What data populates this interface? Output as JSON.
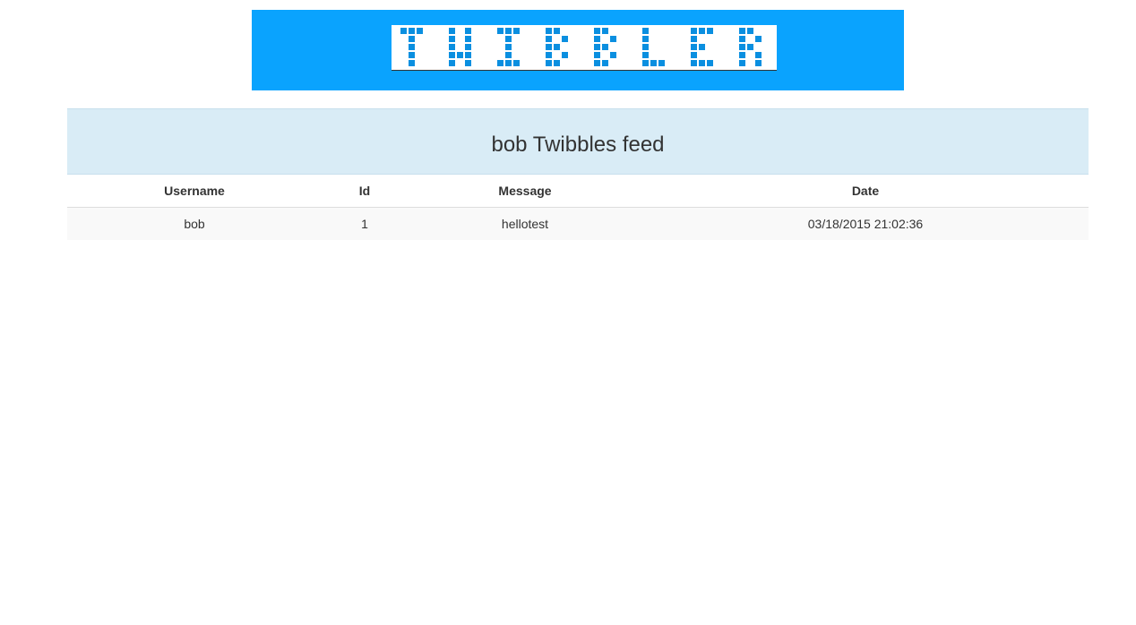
{
  "header": {
    "logo_text": "TWIBBLER",
    "banner_color": "#0aa3fe",
    "logo_pixel_color": "#0a8fe0"
  },
  "feed": {
    "title": "bob Twibbles feed",
    "heading_bg": "#d9ecf6",
    "columns": [
      "Username",
      "Id",
      "Message",
      "Date"
    ],
    "rows": [
      {
        "username": "bob",
        "id": "1",
        "message": "hellotest",
        "date": "03/18/2015 21:02:36"
      }
    ]
  }
}
